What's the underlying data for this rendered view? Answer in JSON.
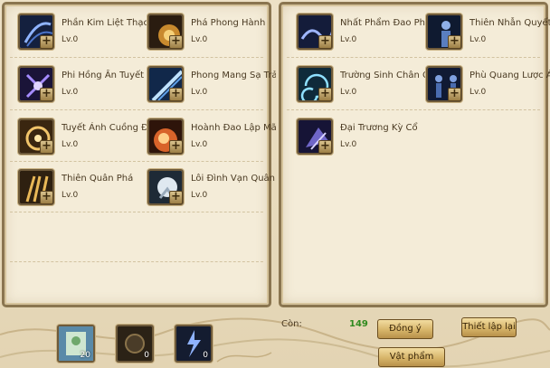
{
  "left_skills": [
    {
      "name": "Phần Kim Liệt Thạch",
      "level": "Lv.0",
      "icon": "skill-icon-blue-arc"
    },
    {
      "name": "Phá Phong Hành",
      "level": "Lv.0",
      "icon": "skill-icon-golden-burst"
    },
    {
      "name": "Phi Hồng Ấn Tuyết",
      "level": "Lv.0",
      "icon": "skill-icon-purple-swirl"
    },
    {
      "name": "Phong Mang Sạ Trảm",
      "level": "Lv.0",
      "icon": "skill-icon-blue-slash"
    },
    {
      "name": "Tuyết Ảnh Cuồng Đao",
      "level": "Lv.0",
      "icon": "skill-icon-golden-ring"
    },
    {
      "name": "Hoành Đao Lập Mã",
      "level": "Lv.0",
      "icon": "skill-icon-orange-flash"
    },
    {
      "name": "Thiên Quân Phá",
      "level": "Lv.0",
      "icon": "skill-icon-golden-claw"
    },
    {
      "name": "Lôi Đình Vạn Quân",
      "level": "Lv.0",
      "icon": "skill-icon-white-storm"
    }
  ],
  "right_skills": [
    {
      "name": "Nhất Phẩm Đao Phách",
      "level": "Lv.0",
      "icon": "skill-icon-blue-wave"
    },
    {
      "name": "Thiên Nhẫn Quyết",
      "level": "Lv.0",
      "icon": "skill-icon-blue-warrior"
    },
    {
      "name": "Trường Sinh Chân Quyết",
      "level": "Lv.0",
      "icon": "skill-icon-cyan-spiral"
    },
    {
      "name": "Phù Quang Lược Ảnh",
      "level": "Lv.0",
      "icon": "skill-icon-blue-figures"
    },
    {
      "name": "Đại Trương Kỳ Cổ",
      "level": "Lv.0",
      "icon": "skill-icon-purple-banner"
    }
  ],
  "inventory_slots": [
    {
      "icon": "scroll-item-icon",
      "count": "20"
    },
    {
      "icon": "dark-orb-item-icon",
      "count": "0"
    },
    {
      "icon": "lightning-item-icon",
      "count": "0"
    }
  ],
  "remaining": {
    "label": "Còn:",
    "value": "149"
  },
  "buttons": {
    "agree": "Đồng ý",
    "reset": "Thiết lập lại",
    "items": "Vật phẩm"
  }
}
